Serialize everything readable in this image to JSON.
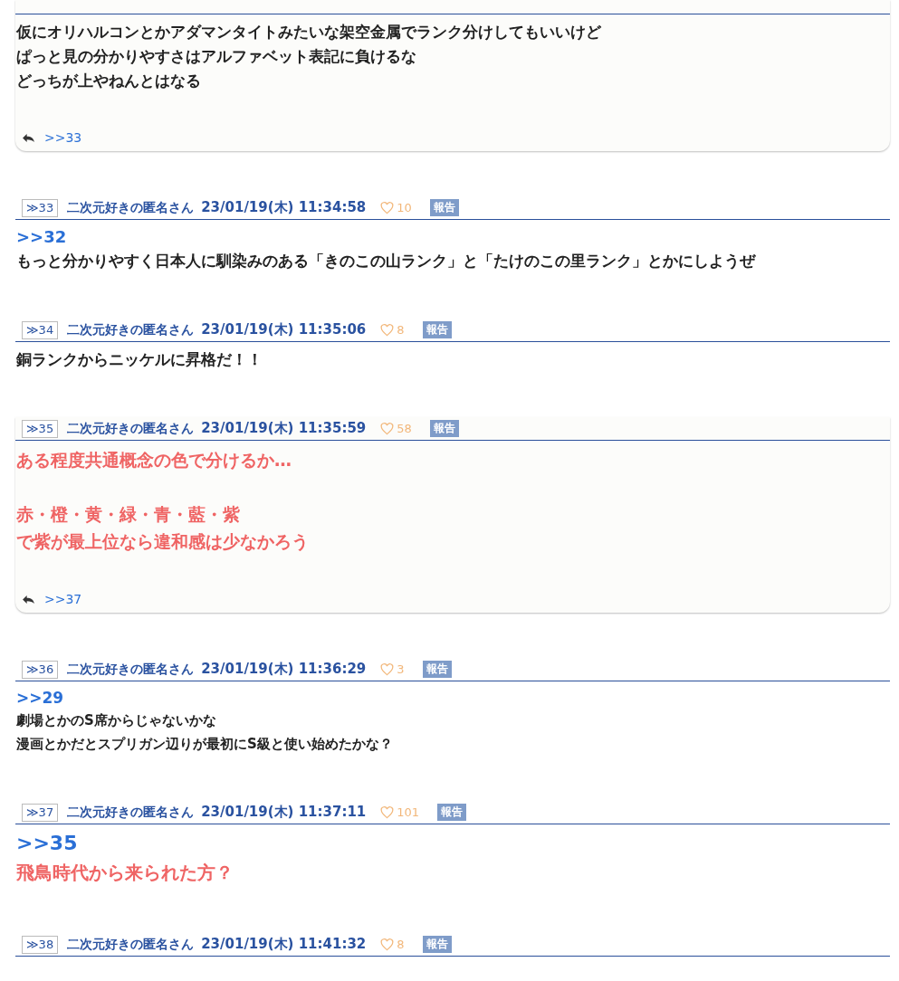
{
  "posts": [
    {
      "kind": "medium",
      "lines": [
        {
          "kind": "plain",
          "text": "仮にオリハルコンとかアダマンタイトみたいな架空金属でランク分けしてもいいけど"
        },
        {
          "kind": "plain",
          "text": "ぱっと見の分かりやすさはアルファベット表記に負けるな"
        },
        {
          "kind": "plain",
          "text": "どっちが上やねんとはなる"
        }
      ],
      "replies": [
        ">>33"
      ]
    },
    {
      "number": "≫33",
      "name": "二次元好きの匿名さん",
      "date": "23/01/19(木) 11:34:58",
      "likes": "10",
      "report": "報告",
      "kind": "medium",
      "lines": [
        {
          "kind": "anchor",
          "text": ">>32"
        },
        {
          "kind": "plain",
          "text": "もっと分かりやすく日本人に馴染みのある「きのこの山ランク」と「たけのこの里ランク」とかにしようぜ"
        }
      ]
    },
    {
      "number": "≫34",
      "name": "二次元好きの匿名さん",
      "date": "23/01/19(木) 11:35:06",
      "likes": "8",
      "report": "報告",
      "kind": "medium",
      "lines": [
        {
          "kind": "plain",
          "text": "銅ランクからニッケルに昇格だ！！"
        }
      ]
    },
    {
      "number": "≫35",
      "name": "二次元好きの匿名さん",
      "date": "23/01/19(木) 11:35:59",
      "likes": "58",
      "report": "報告",
      "kind": "medium",
      "lines": [
        {
          "kind": "red",
          "text": "ある程度共通概念の色で分けるか…"
        },
        {
          "kind": "gap"
        },
        {
          "kind": "red",
          "text": "赤・橙・黄・緑・青・藍・紫"
        },
        {
          "kind": "red",
          "text": "で紫が最上位なら違和感は少なかろう"
        }
      ],
      "replies": [
        ">>37"
      ]
    },
    {
      "number": "≫36",
      "name": "二次元好きの匿名さん",
      "date": "23/01/19(木) 11:36:29",
      "likes": "3",
      "report": "報告",
      "kind": "small",
      "lines": [
        {
          "kind": "anchor",
          "text": ">>29"
        },
        {
          "kind": "plain",
          "text": "劇場とかのS席からじゃないかな"
        },
        {
          "kind": "plain",
          "text": "漫画とかだとスプリガン辺りが最初にS級と使い始めたかな？"
        }
      ]
    },
    {
      "number": "≫37",
      "name": "二次元好きの匿名さん",
      "date": "23/01/19(木) 11:37:11",
      "likes": "101",
      "report": "報告",
      "kind": "large",
      "lines": [
        {
          "kind": "anchor",
          "text": ">>35"
        },
        {
          "kind": "red",
          "text": "飛鳥時代から来られた方？"
        }
      ]
    },
    {
      "number": "≫38",
      "name": "二次元好きの匿名さん",
      "date": "23/01/19(木) 11:41:32",
      "likes": "8",
      "report": "報告"
    }
  ]
}
